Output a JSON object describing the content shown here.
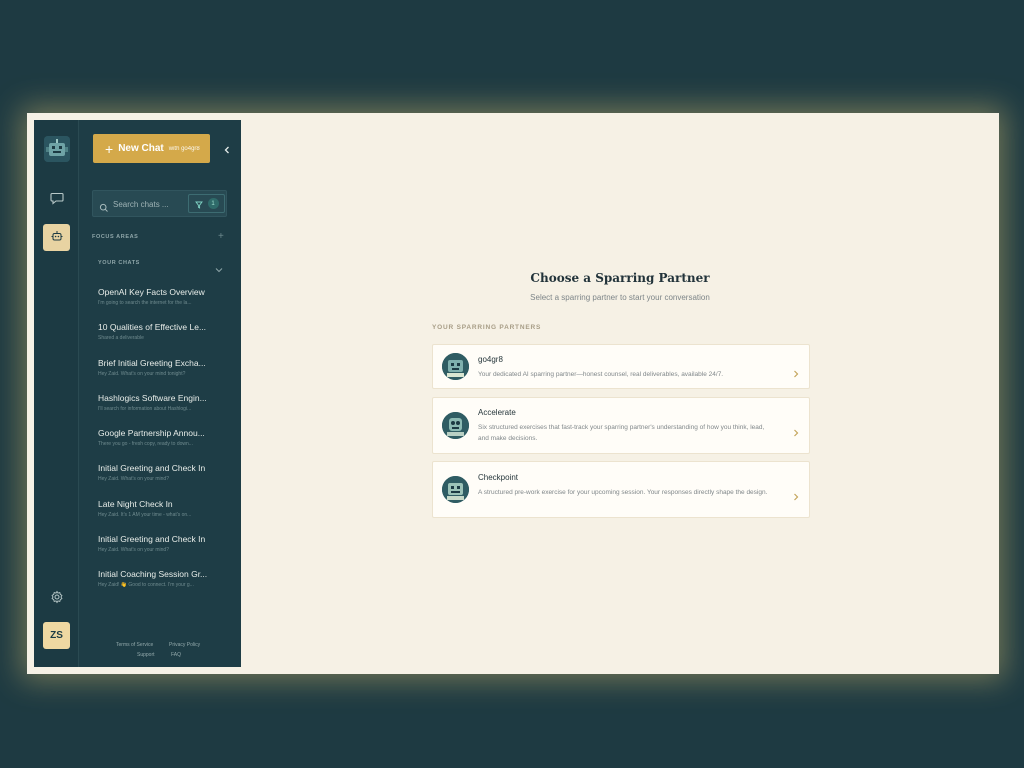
{
  "rail": {
    "avatar_initials": "ZS"
  },
  "sidebar": {
    "new_chat_label": "New Chat",
    "new_chat_sub": "with go4gr8",
    "search_placeholder": "Search chats ...",
    "filter_count": "1",
    "focus_areas_label": "FOCUS AREAS",
    "your_chats_label": "YOUR CHATS",
    "chats": [
      {
        "title": "OpenAI Key Facts Overview",
        "preview": "I'm going to search the internet for the la..."
      },
      {
        "title": "10 Qualities of Effective Le...",
        "preview": "Shared a deliverable"
      },
      {
        "title": "Brief Initial Greeting Excha...",
        "preview": "Hey Zaid. What's on your mind tonight?"
      },
      {
        "title": "Hashlogics Software Engin...",
        "preview": "I'll search for information about Hashlogi..."
      },
      {
        "title": "Google Partnership Annou...",
        "preview": "There you go - fresh copy, ready to down..."
      },
      {
        "title": "Initial Greeting and Check In",
        "preview": "Hey Zaid. What's on your mind?"
      },
      {
        "title": "Late Night Check In",
        "preview": "Hey Zaid. It's 1 AM your time - what's on..."
      },
      {
        "title": "Initial Greeting and Check In",
        "preview": "Hey Zaid. What's on your mind?"
      },
      {
        "title": "Initial Coaching Session Gr...",
        "preview": "Hey Zaid! 👋 Good to connect. I'm your g..."
      }
    ],
    "footer": {
      "terms": "Terms of Service",
      "privacy": "Privacy Policy",
      "support": "Support",
      "faq": "FAQ"
    }
  },
  "main": {
    "title": "Choose a Sparring Partner",
    "subtitle": "Select a sparring partner to start your conversation",
    "partners_label": "YOUR SPARRING PARTNERS",
    "partners": [
      {
        "name": "go4gr8",
        "description": "Your dedicated AI sparring partner—honest counsel, real deliverables, available 24/7."
      },
      {
        "name": "Accelerate",
        "description": "Six structured exercises that fast-track your sparring partner's understanding of how you think, lead, and make decisions."
      },
      {
        "name": "Checkpoint",
        "description": "A structured pre-work exercise for your upcoming session. Your responses directly shape the design."
      }
    ]
  },
  "colors": {
    "page_background": "#1e3a42",
    "sidebar_background": "#1e3d46",
    "accent_gold": "#d4a94a",
    "content_background": "#f6f1e5",
    "avatar_background": "#efd8a2"
  },
  "icons": {
    "logo": "robot-logo-icon",
    "chat": "chat-bubble-icon",
    "partners": "robot-icon",
    "settings": "gear-icon",
    "search": "search-icon",
    "filter": "filter-icon",
    "collapse": "chevron-left-icon",
    "card_arrow": "chevron-right-icon"
  }
}
